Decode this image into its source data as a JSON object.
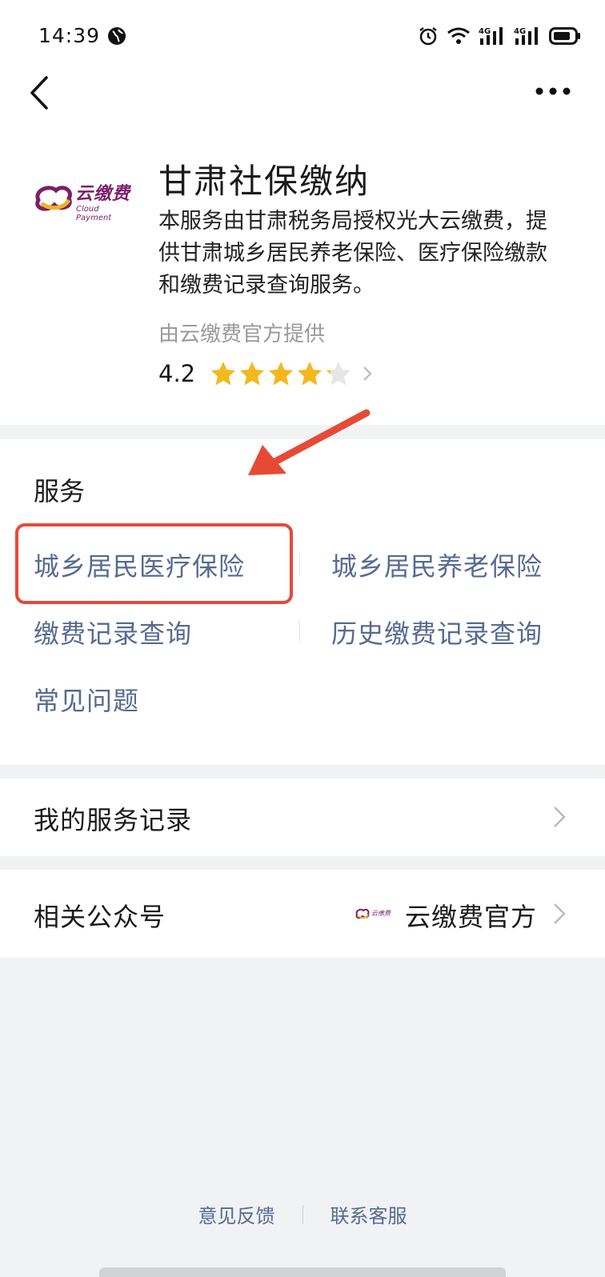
{
  "status_bar": {
    "time": "14:39",
    "signal_1": "4G",
    "signal_2": "4G"
  },
  "nav": {
    "back_icon": "chevron-left-icon",
    "more_icon": "more-horizontal-icon"
  },
  "app": {
    "logo_text_cn": "云缴费",
    "logo_text_en": "Cloud Payment",
    "title": "甘肃社保缴纳",
    "description": "本服务由甘肃税务局授权光大云缴费，提供甘肃城乡居民养老保险、医疗保险缴款和缴费记录查询服务。",
    "provider": "由云缴费官方提供",
    "rating": "4.2",
    "rating_stars": 4.2,
    "star_color": "#f5b81c"
  },
  "services": {
    "title": "服务",
    "items": [
      "城乡居民医疗保险",
      "城乡居民养老保险",
      "缴费记录查询",
      "历史缴费记录查询",
      "常见问题"
    ],
    "link_color": "#566a92",
    "highlight_color": "#e64a35"
  },
  "my_records": {
    "label": "我的服务记录"
  },
  "official_account": {
    "label": "相关公众号",
    "value": "云缴费官方"
  },
  "footer": {
    "feedback": "意见反馈",
    "customer_service": "联系客服"
  }
}
